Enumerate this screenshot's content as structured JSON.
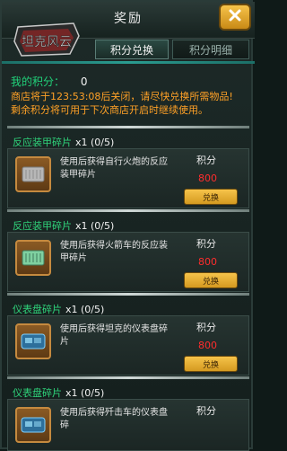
{
  "header": {
    "title": "奖励",
    "logo_text": "坦克风云",
    "close_icon": "close-icon"
  },
  "tabs": {
    "active": "积分兑换",
    "inactive": "积分明细"
  },
  "points": {
    "label": "我的积分：",
    "value": "0"
  },
  "notice": {
    "line1": "商店将于123:53:08后关闭，请尽快兑换所需物品!",
    "line2": "剩余积分将可用于下次商店开启时继续使用。"
  },
  "items": [
    {
      "title": "反应装甲碎片",
      "count": "x1 (0/5)",
      "desc": "使用后获得自行火炮的反应装甲碎片",
      "score_label": "积分",
      "cost": "800",
      "button": "兑换",
      "thumb_icon": "armor-shard-icon"
    },
    {
      "title": "反应装甲碎片",
      "count": "x1 (0/5)",
      "desc": "使用后获得火箭车的反应装甲碎片",
      "score_label": "积分",
      "cost": "800",
      "button": "兑换",
      "thumb_icon": "armor-shard-icon"
    },
    {
      "title": "仪表盘碎片",
      "count": "x1 (0/5)",
      "desc": "使用后获得坦克的仪表盘碎片",
      "score_label": "积分",
      "cost": "800",
      "button": "兑换",
      "thumb_icon": "dashboard-shard-icon"
    },
    {
      "title": "仪表盘碎片",
      "count": "x1 (0/5)",
      "desc": "使用后获得歼击车的仪表盘碎",
      "score_label": "积分",
      "cost": "",
      "button": "",
      "thumb_icon": "dashboard-shard-icon"
    }
  ],
  "colors": {
    "green": "#21d27a",
    "orange": "#ffa126",
    "red": "#ff2d2d",
    "gold": "#f6c34a"
  }
}
